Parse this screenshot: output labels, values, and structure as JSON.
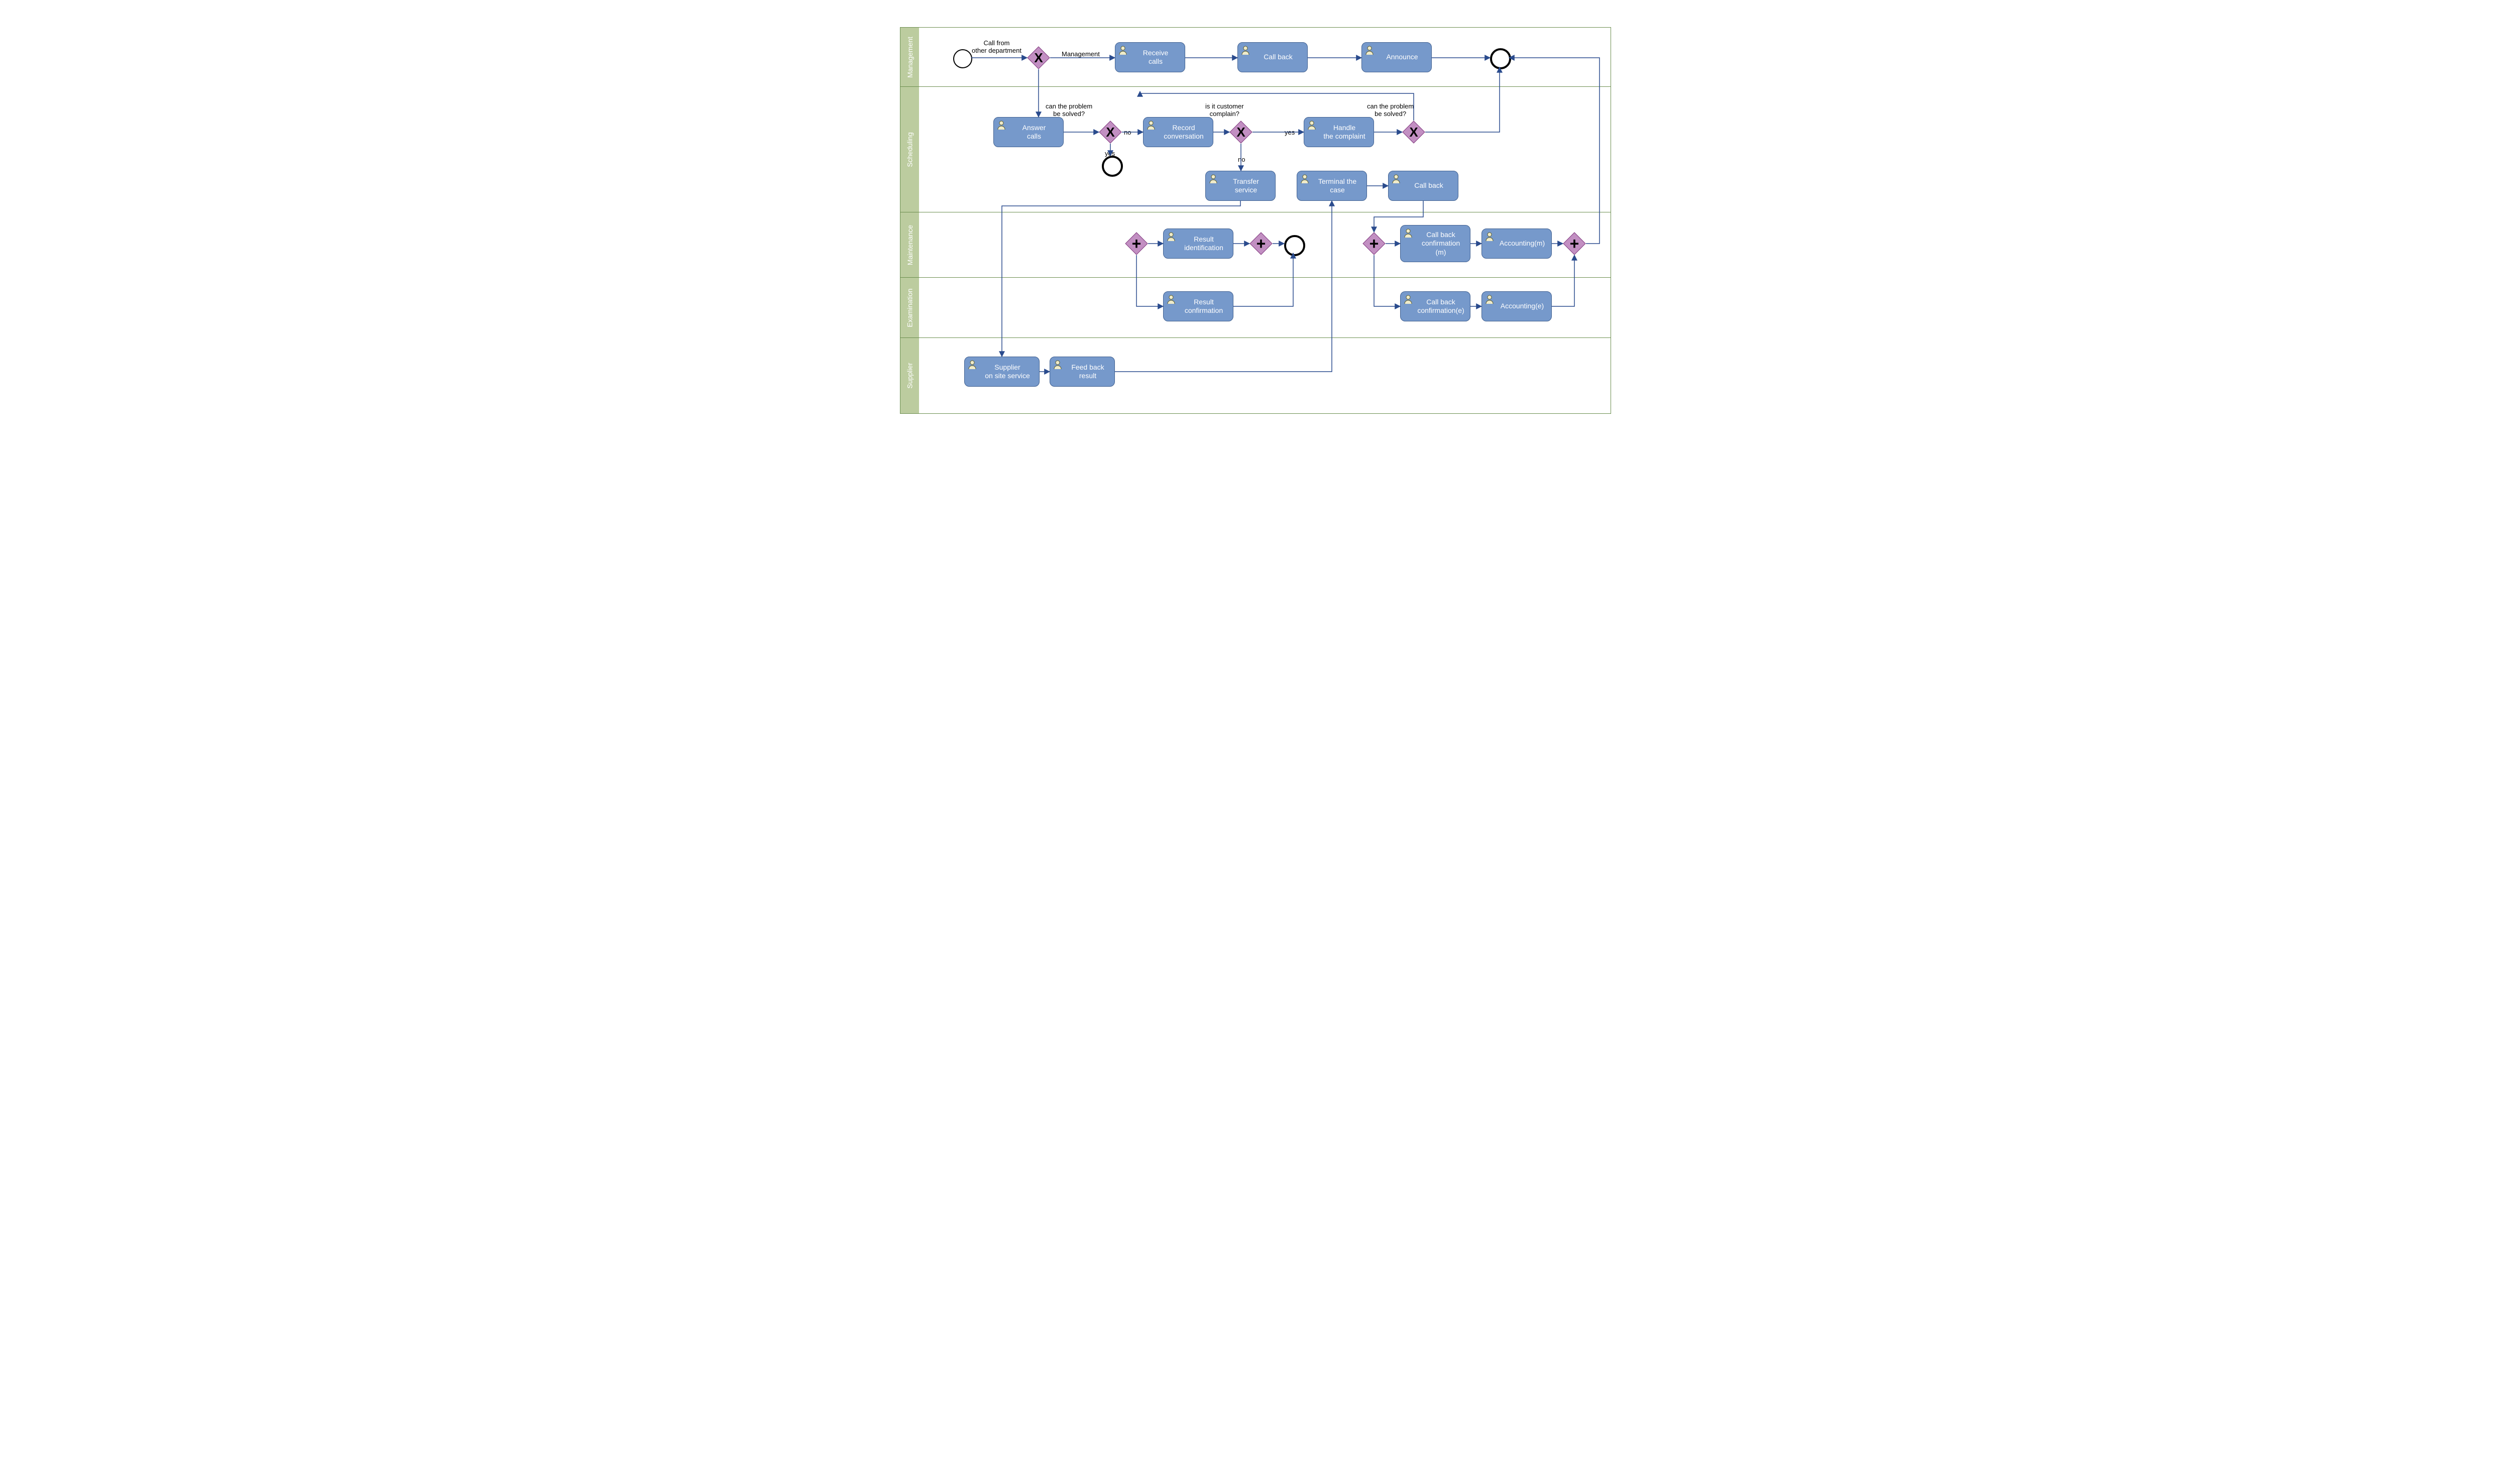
{
  "lanes": {
    "management": "Management",
    "scheduling": "Scheduling",
    "maintenance": "Maintenance",
    "examination": "Examination",
    "supplier": "Supplier"
  },
  "labels": {
    "call_from": "Call from\nother department",
    "management_path": "Management",
    "can_solve1": "can the problem\nbe solved?",
    "is_complain": "is it customer\ncomplain?",
    "can_solve2": "can the problem\nbe solved?",
    "no1": "no",
    "yes1": "yes",
    "no2": "no",
    "yes2": "yes"
  },
  "tasks": {
    "receive_calls": "Receive\ncalls",
    "call_back_m": "Call back",
    "announce": "Announce",
    "answer_calls": "Answer\ncalls",
    "record_conv": "Record\nconversation",
    "handle_complaint": "Handle\nthe complaint",
    "transfer_service": "Transfer\nservice",
    "terminal_case": "Terminal the\ncase",
    "call_back_s": "Call back",
    "result_ident": "Result\nidentification",
    "callback_conf_m": "Call back\nconfirmation\n(m)",
    "accounting_m": "Accounting(m)",
    "result_conf": "Result\nconfirmation",
    "callback_conf_e": "Call back\nconfirmation(e)",
    "accounting_e": "Accounting(e)",
    "supplier_onsite": "Supplier\non site service",
    "feedback_result": "Feed back\nresult"
  }
}
